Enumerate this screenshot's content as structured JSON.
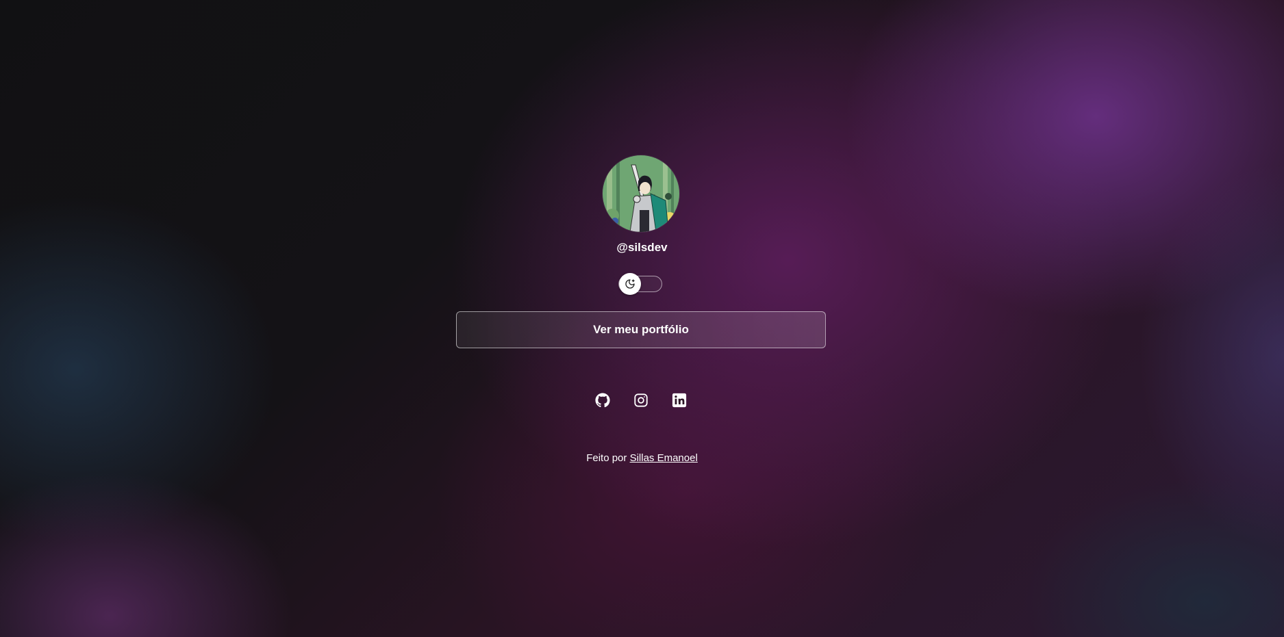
{
  "profile": {
    "handle": "@silsdev",
    "avatar_alt": "avatar"
  },
  "theme_toggle": {
    "icon": "moon-stars-icon",
    "state": "dark"
  },
  "portfolio_button": {
    "label": "Ver meu portfólio"
  },
  "socials": [
    {
      "name": "github",
      "icon": "github-icon"
    },
    {
      "name": "instagram",
      "icon": "instagram-icon"
    },
    {
      "name": "linkedin",
      "icon": "linkedin-icon"
    }
  ],
  "footer": {
    "prefix": "Feito por",
    "author": "Sillas Emanoel"
  },
  "colors": {
    "text": "#ffffff",
    "accent_purple": "#6e328c",
    "background": "#111114"
  }
}
